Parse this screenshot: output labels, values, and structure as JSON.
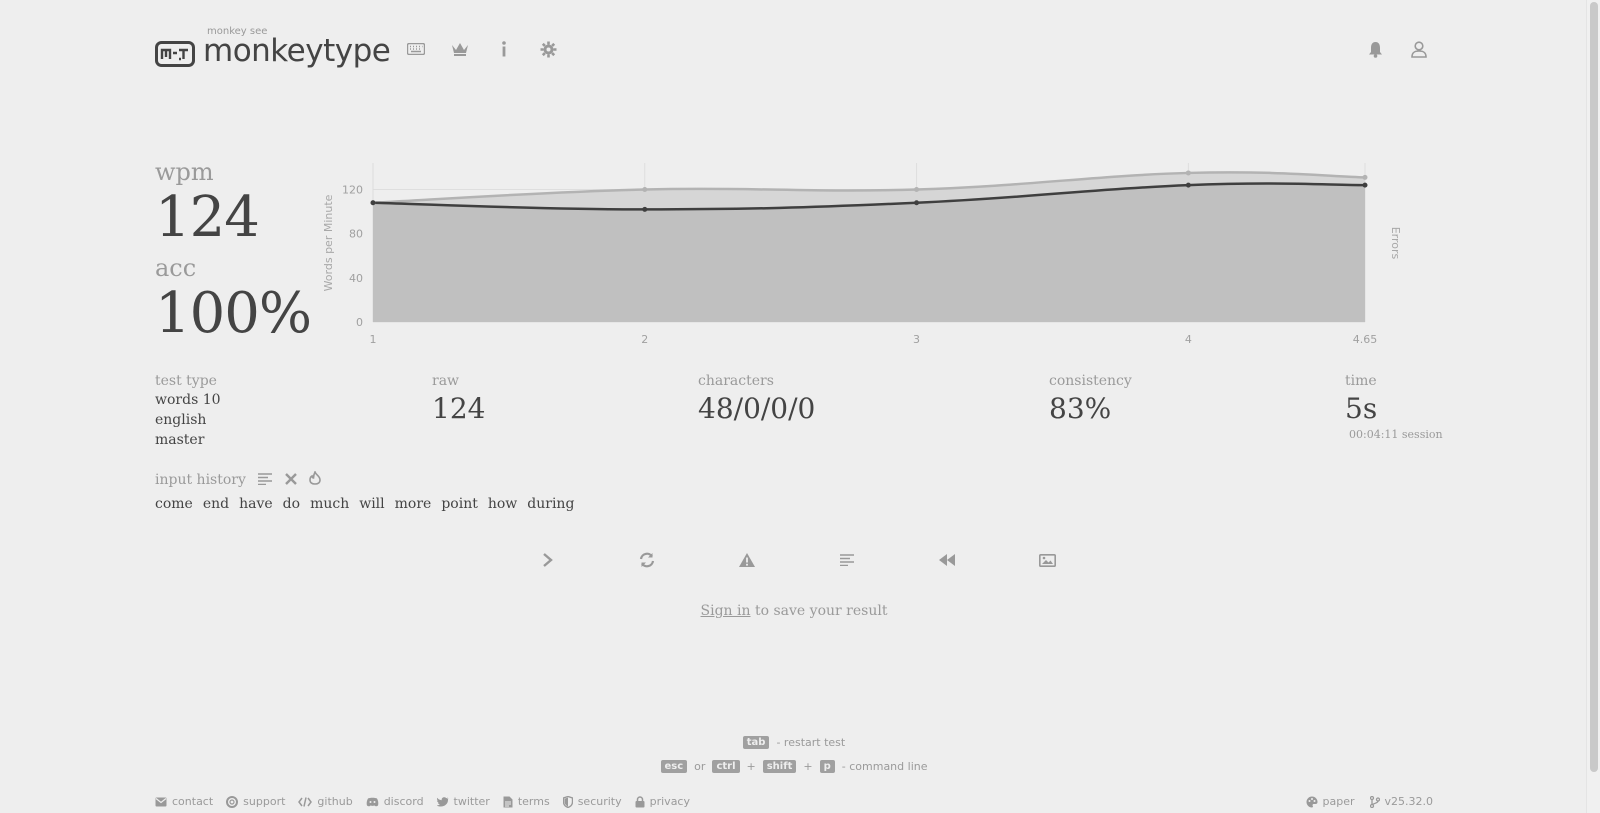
{
  "header": {
    "logo_top": "monkey see",
    "logo_title": "monkeytype",
    "nav": [
      "keyboard-icon",
      "crown-icon",
      "info-icon",
      "gear-icon"
    ],
    "right_nav": [
      "bell-icon",
      "user-icon"
    ]
  },
  "result": {
    "wpm_label": "wpm",
    "wpm_value": "124",
    "acc_label": "acc",
    "acc_value": "100%"
  },
  "stats": {
    "test_type_label": "test type",
    "test_type_lines": [
      "words 10",
      "english",
      "master"
    ],
    "raw_label": "raw",
    "raw_value": "124",
    "characters_label": "characters",
    "characters_value": "48/0/0/0",
    "consistency_label": "consistency",
    "consistency_value": "83%",
    "time_label": "time",
    "time_value": "5s",
    "session_value": "00:04:11 session"
  },
  "history": {
    "label": "input history",
    "words": [
      "come",
      "end",
      "have",
      "do",
      "much",
      "will",
      "more",
      "point",
      "how",
      "during"
    ]
  },
  "actions": [
    "next-test-icon",
    "restart-icon",
    "report-icon",
    "words-list-icon",
    "replay-icon",
    "screenshot-icon"
  ],
  "signin": {
    "link": "Sign in",
    "rest": " to save your result"
  },
  "hints": {
    "tab_key": "tab",
    "tab_text": "- restart test",
    "esc_key": "esc",
    "or": "or",
    "ctrl_key": "ctrl",
    "plus": "+",
    "shift_key": "shift",
    "p_key": "p",
    "cmd_text": "- command line"
  },
  "footer": {
    "left": [
      "contact",
      "support",
      "github",
      "discord",
      "twitter",
      "terms",
      "security",
      "privacy"
    ],
    "theme": "paper",
    "version": "v25.32.0"
  },
  "colors": {
    "background": "#eeeeee",
    "text": "#444444",
    "sub": "#9a9a9a",
    "area_raw": "#d5d5d5",
    "area_wpm": "#c0c0c0"
  },
  "chart_data": {
    "type": "area",
    "x": [
      1,
      2,
      3,
      4,
      4.65
    ],
    "x_tick_labels": [
      "1",
      "2",
      "3",
      "4",
      "4.65"
    ],
    "ylabel": "Words per Minute",
    "y2label": "Errors",
    "ylim": [
      0,
      144
    ],
    "y_ticks": [
      0,
      40,
      80,
      120
    ],
    "grid": true,
    "series": [
      {
        "values": [
          108,
          120,
          120,
          135,
          131
        ]
      },
      {
        "values": [
          108,
          102,
          108,
          124,
          124
        ]
      }
    ]
  }
}
